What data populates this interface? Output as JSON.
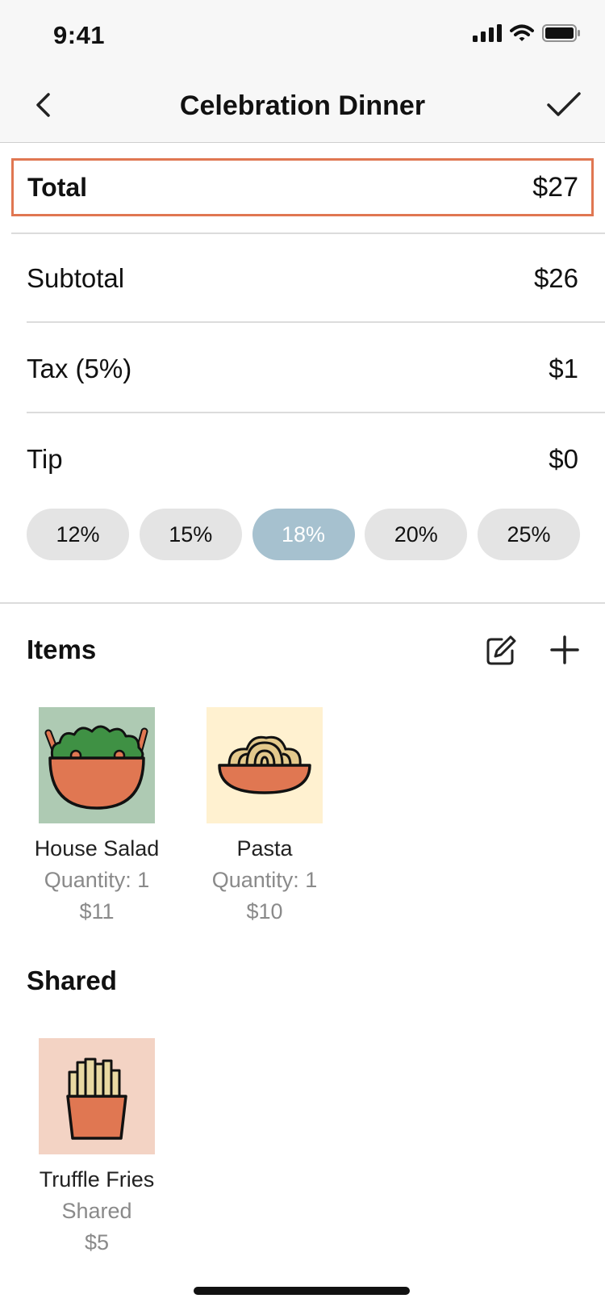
{
  "status_bar": {
    "time": "9:41"
  },
  "nav": {
    "title": "Celebration Dinner"
  },
  "summary": {
    "total_label": "Total",
    "total_value": "$27",
    "subtotal_label": "Subtotal",
    "subtotal_value": "$26",
    "tax_label": "Tax (5%)",
    "tax_value": "$1",
    "tip_label": "Tip",
    "tip_value": "$0"
  },
  "tip_options": [
    "12%",
    "15%",
    "18%",
    "20%",
    "25%"
  ],
  "tip_selected": "18%",
  "items_section": {
    "title": "Items",
    "items": [
      {
        "name": "House Salad",
        "detail": "Quantity: 1",
        "price": "$11",
        "icon": "salad-icon",
        "color": "#aecab3"
      },
      {
        "name": "Pasta",
        "detail": "Quantity: 1",
        "price": "$10",
        "icon": "pasta-icon",
        "color": "#fff1d0"
      }
    ]
  },
  "shared_section": {
    "title": "Shared",
    "items": [
      {
        "name": "Truffle Fries",
        "detail": "Shared",
        "price": "$5",
        "icon": "fries-icon",
        "color": "#f3d3c4"
      }
    ]
  },
  "colors": {
    "accent": "#e07752",
    "tip_selected": "#a6c1cf",
    "tip_default": "#e4e4e4"
  }
}
